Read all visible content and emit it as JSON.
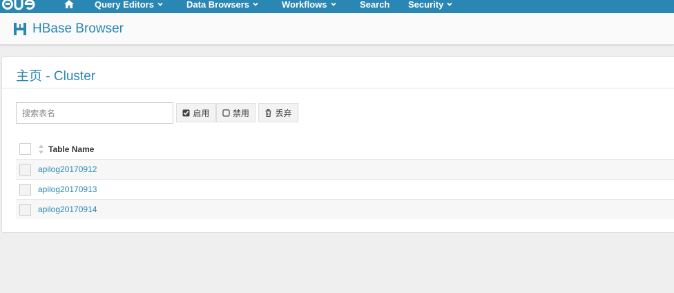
{
  "topnav": {
    "logo": "HUE",
    "items": [
      {
        "label": "Query Editors"
      },
      {
        "label": "Data Browsers"
      },
      {
        "label": "Workflows"
      },
      {
        "label": "Search"
      },
      {
        "label": "Security"
      }
    ]
  },
  "app": {
    "title": "HBase Browser"
  },
  "card": {
    "breadcrumb_home": "主页",
    "breadcrumb_sep": " - ",
    "breadcrumb_current": "Cluster"
  },
  "toolbar": {
    "search_placeholder": "搜索表名",
    "enable_label": "启用",
    "disable_label": "禁用",
    "drop_label": "丢弃"
  },
  "table": {
    "column_header": "Table Name",
    "rows": [
      {
        "name": "apilog20170912"
      },
      {
        "name": "apilog20170913"
      },
      {
        "name": "apilog20170914"
      }
    ]
  },
  "colors": {
    "accent": "#2A87B4",
    "background": "#efefef"
  }
}
